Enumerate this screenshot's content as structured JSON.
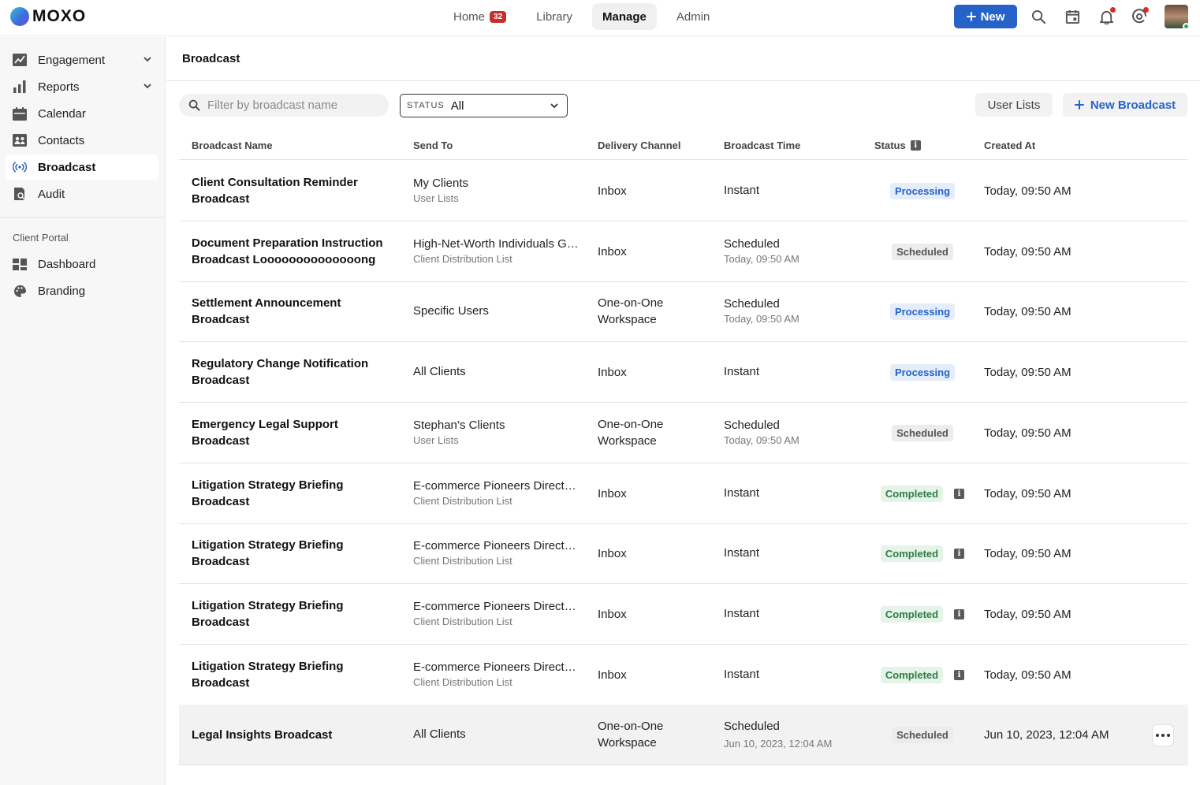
{
  "app": {
    "logo_text": "MOXO"
  },
  "topnav": {
    "items": [
      {
        "label": "Home",
        "badge": "32"
      },
      {
        "label": "Library"
      },
      {
        "label": "Manage"
      },
      {
        "label": "Admin"
      }
    ],
    "active": "Manage",
    "new_label": "New"
  },
  "sidebar": {
    "items": [
      {
        "label": "Engagement",
        "icon": "engagement-icon"
      },
      {
        "label": "Reports",
        "icon": "reports-icon"
      },
      {
        "label": "Calendar",
        "icon": "calendar-icon"
      },
      {
        "label": "Contacts",
        "icon": "contacts-icon"
      },
      {
        "label": "Broadcast",
        "icon": "broadcast-icon"
      },
      {
        "label": "Audit",
        "icon": "audit-icon"
      }
    ],
    "section_title": "Client Portal",
    "portal_items": [
      {
        "label": "Dashboard",
        "icon": "dashboard-icon"
      },
      {
        "label": "Branding",
        "icon": "palette-icon"
      }
    ]
  },
  "main": {
    "title": "Broadcast",
    "filter_placeholder": "Filter by broadcast name",
    "status_label": "STATUS",
    "status_value": "All",
    "user_lists_label": "User Lists",
    "new_broadcast_label": "New Broadcast"
  },
  "table": {
    "headers": [
      "Broadcast Name",
      "Send To",
      "Delivery Channel",
      "Broadcast Time",
      "Status",
      "Created At"
    ],
    "rows": [
      {
        "name": "Client Consultation Reminder Broadcast",
        "send_to": "My Clients",
        "send_sub": "User Lists",
        "channel": "Inbox",
        "time": "Instant",
        "time_sub": "",
        "status": "Processing",
        "created": "Today, 09:50 AM"
      },
      {
        "name": "Document Preparation Instruction Broadcast Loooooooooooooong",
        "send_to": "High-Net-Worth Individuals Group",
        "send_sub": "Client Distribution List",
        "channel": "Inbox",
        "time": "Scheduled",
        "time_sub": "Today, 09:50 AM",
        "status": "Scheduled",
        "created": "Today, 09:50 AM"
      },
      {
        "name": "Settlement Announcement Broadcast",
        "send_to": "Specific Users",
        "send_sub": "",
        "channel": "One-on-One Workspace",
        "time": "Scheduled",
        "time_sub": "Today, 09:50 AM",
        "status": "Processing",
        "created": "Today, 09:50 AM"
      },
      {
        "name": "Regulatory Change Notification Broadcast",
        "send_to": "All Clients",
        "send_sub": "",
        "channel": "Inbox",
        "time": "Instant",
        "time_sub": "",
        "status": "Processing",
        "created": "Today, 09:50 AM"
      },
      {
        "name": "Emergency Legal Support Broadcast",
        "send_to": "Stephan’s Clients",
        "send_sub": "User Lists",
        "channel": "One-on-One Workspace",
        "time": "Scheduled",
        "time_sub": "Today, 09:50 AM",
        "status": "Scheduled",
        "created": "Today, 09:50 AM"
      },
      {
        "name": "Litigation Strategy Briefing Broadcast",
        "send_to": "E-commerce Pioneers Directory",
        "send_sub": "Client Distribution List",
        "channel": "Inbox",
        "time": "Instant",
        "time_sub": "",
        "status": "Completed",
        "created": "Today, 09:50 AM"
      },
      {
        "name": "Litigation Strategy Briefing Broadcast",
        "send_to": "E-commerce Pioneers Directory",
        "send_sub": "Client Distribution List",
        "channel": "Inbox",
        "time": "Instant",
        "time_sub": "",
        "status": "Completed",
        "created": "Today, 09:50 AM"
      },
      {
        "name": "Litigation Strategy Briefing Broadcast",
        "send_to": "E-commerce Pioneers Directory",
        "send_sub": "Client Distribution List",
        "channel": "Inbox",
        "time": "Instant",
        "time_sub": "",
        "status": "Completed",
        "created": "Today, 09:50 AM"
      },
      {
        "name": "Litigation Strategy Briefing Broadcast",
        "send_to": "E-commerce Pioneers Directory",
        "send_sub": "Client Distribution List",
        "channel": "Inbox",
        "time": "Instant",
        "time_sub": "",
        "status": "Completed",
        "created": "Today, 09:50 AM"
      },
      {
        "name": "Legal Insights Broadcast",
        "send_to": "All Clients",
        "send_sub": "",
        "channel": "One-on-One Workspace",
        "time": "Scheduled",
        "time_sub": "Jun 10, 2023, 12:04 AM",
        "status": "Scheduled",
        "created": "Jun 10, 2023, 12:04 AM"
      }
    ]
  },
  "colors": {
    "accent": "#2563c9",
    "processing": "#2563c9",
    "completed": "#2e7d43",
    "badge": "#c4302b"
  }
}
